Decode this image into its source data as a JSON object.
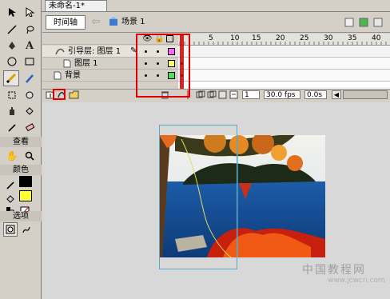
{
  "document": {
    "tab_title": "未命名-1*"
  },
  "header": {
    "timeline_tab": "时间轴",
    "scene_label": "场景 1"
  },
  "toolbox": {
    "view_label": "查看",
    "colors_label": "颜色",
    "options_label": "选项",
    "tools": [
      "arrow-icon",
      "subselect-icon",
      "line-icon",
      "lasso-icon",
      "pen-icon",
      "text-icon",
      "oval-icon",
      "rectangle-icon",
      "pencil-icon",
      "brush-icon",
      "free-transform-icon",
      "fill-transform-icon",
      "ink-bottle-icon",
      "paint-bucket-icon",
      "eyedropper-icon",
      "eraser-icon",
      "hand-icon",
      "zoom-icon"
    ],
    "stroke_color": "#000000",
    "fill_color": "#ffff33"
  },
  "timeline": {
    "layers": [
      {
        "name": "引导层: 图层 1",
        "color": "#ff66ff",
        "selected": true
      },
      {
        "name": "图层 1",
        "color": "#ffff66",
        "selected": false
      },
      {
        "name": "背景",
        "color": "#55dd55",
        "selected": false
      }
    ],
    "ruler_ticks": [
      "5",
      "10",
      "15",
      "20",
      "25",
      "30",
      "35",
      "40"
    ],
    "current_frame": "1",
    "fps": "30.0 fps",
    "time": "0.0s"
  },
  "watermark": {
    "text": "中国教程网",
    "url": "www.jcwcn.com"
  },
  "colors": {
    "accent_red": "#e00000",
    "guide_blue": "#5aa7c8"
  }
}
